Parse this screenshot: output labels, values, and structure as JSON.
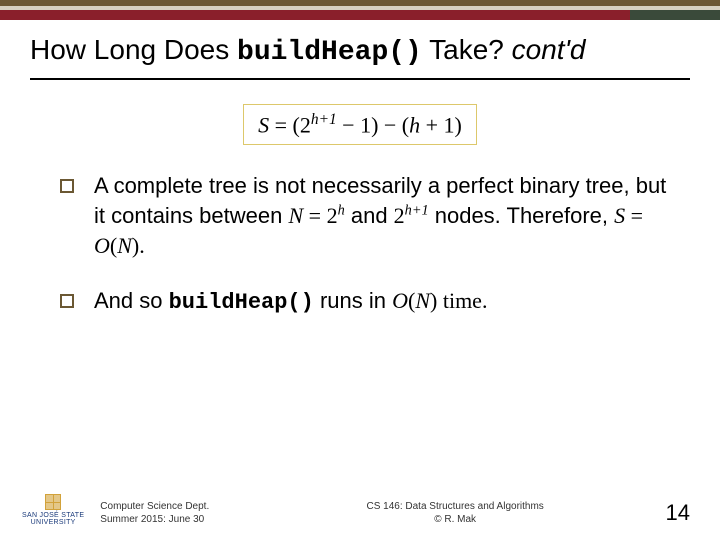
{
  "title": {
    "prefix": "How Long Does ",
    "code": "buildHeap()",
    "suffix": " Take? ",
    "tail_italic": "cont'd"
  },
  "formula": {
    "lhs": "S",
    "eq": " = (2",
    "exp1": "h+1",
    "mid": " − 1) − (",
    "h": "h",
    "plus1": " + 1)"
  },
  "bullets": {
    "b1": {
      "t1": "A complete tree is not necessarily a perfect binary tree, but it contains between ",
      "n": "N",
      "eq": " = ",
      "two": "2",
      "exp_h": "h",
      "and": " and ",
      "two2": "2",
      "exp_h1": "h+1",
      "nodes": " nodes. Therefore, ",
      "s": "S",
      "eq2": " = ",
      "o": "O",
      "open": "(",
      "n2": "N",
      "close": ")."
    },
    "b2": {
      "t1": "And so ",
      "code": "buildHeap()",
      "t2": " runs in ",
      "o": "O",
      "open": "(",
      "n": "N",
      "close": ") time."
    }
  },
  "footer": {
    "logo_line1": "SAN JOSÉ STATE",
    "logo_line2": "UNIVERSITY",
    "left_line1": "Computer Science Dept.",
    "left_line2": "Summer 2015: June 30",
    "center_line1": "CS 146: Data Structures and Algorithms",
    "center_line2": "© R. Mak",
    "page": "14"
  }
}
